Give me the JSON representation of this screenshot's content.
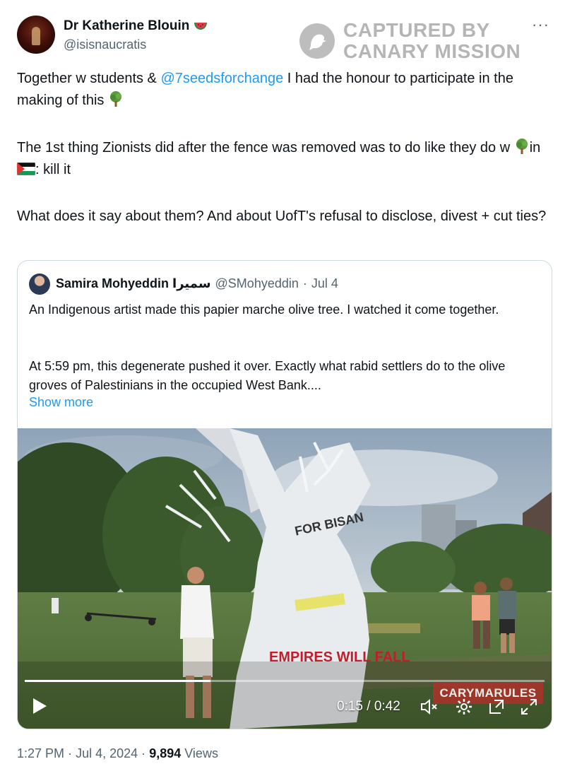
{
  "author": {
    "display_name": "Dr Katherine Blouin",
    "handle": "@isisnaucratis",
    "badge_icon": "watermelon-icon"
  },
  "watermark": {
    "line1": "CAPTURED BY",
    "line2": "CANARY MISSION"
  },
  "tweet": {
    "p1_a": "Together w students & ",
    "p1_mention": "@7seedsforchange",
    "p1_b": " I had the honour to participate in the making of this ",
    "p2_a": "The 1st thing Zionists did after the fence was removed was to do like they do w ",
    "p2_b": "in ",
    "p2_c": ": kill it",
    "p3": "What does it say about them? And about UofT's refusal to disclose, divest + cut ties?"
  },
  "quoted": {
    "display_name": "Samira Mohyeddin سميرا",
    "handle": "@SMohyeddin",
    "dot": "·",
    "date": "Jul 4",
    "p1": "An Indigenous artist made this papier marche olive tree. I watched it come together.",
    "p2": "At 5:59 pm, this degenerate pushed it over. Exactly what rabid settlers do to the olive groves of Palestinians in the occupied West Bank....",
    "show_more": "Show more",
    "video": {
      "time": "0:15 / 0:42",
      "progress": 0.357,
      "badge": "CARYMARULES",
      "sign_text_1": "FOR BISAN",
      "sign_text_2": "EMPIRES WILL FALL"
    }
  },
  "footer": {
    "time": "1:27 PM",
    "dot": "·",
    "date": "Jul 4, 2024",
    "views": "9,894",
    "views_label": "Views"
  },
  "colors": {
    "link": "#1d9bf0",
    "secondary_text": "#536471",
    "border": "#cfd9de"
  }
}
